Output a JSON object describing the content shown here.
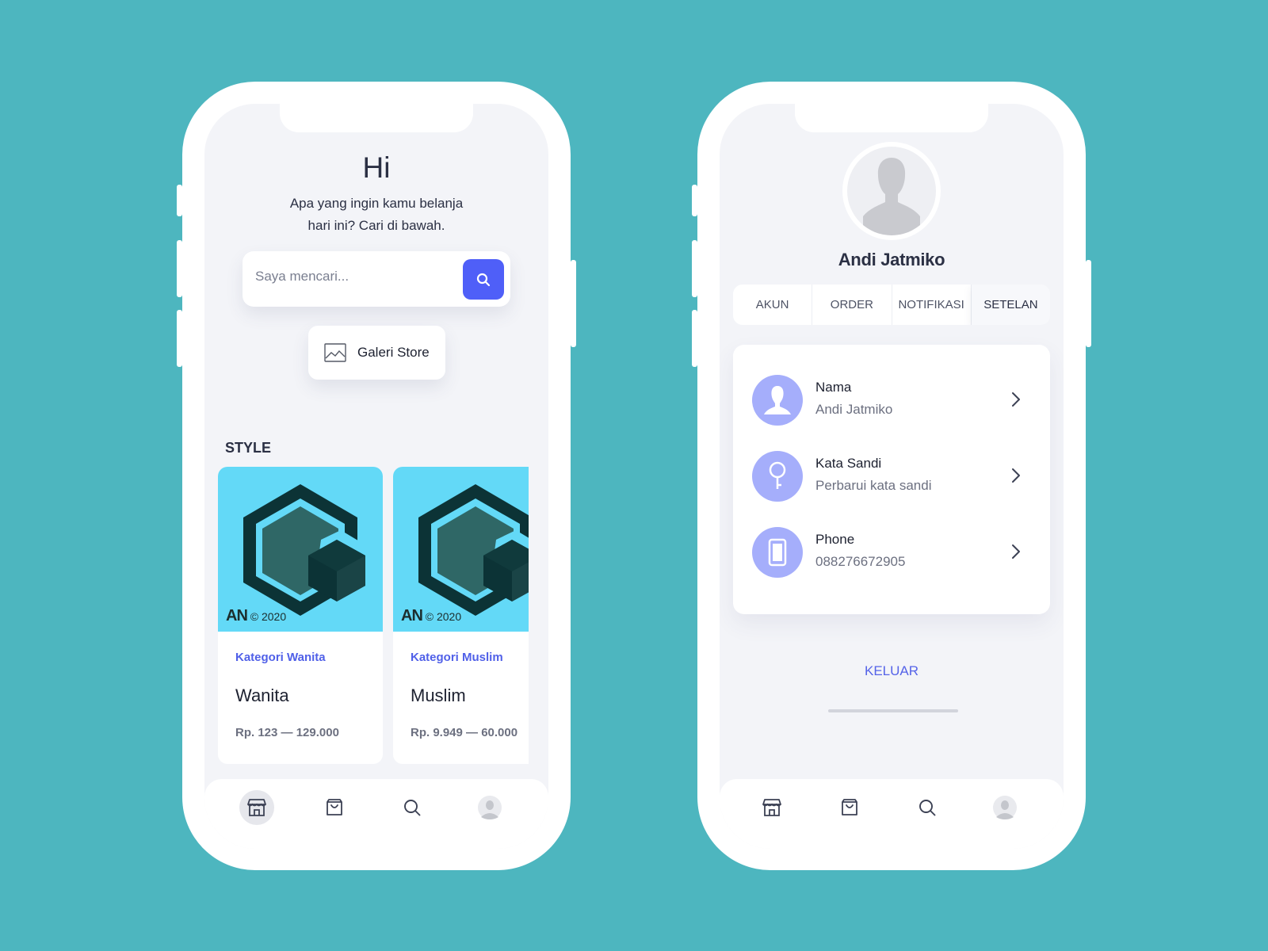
{
  "home": {
    "greeting": "Hi",
    "subtitle_line1": "Apa yang ingin kamu belanja",
    "subtitle_line2": "hari ini? Cari di bawah.",
    "search_placeholder": "Saya mencari...",
    "gallery_button": "Galeri Store",
    "section_title": "STYLE",
    "cards": [
      {
        "logo": "AN",
        "copyright": "© 2020",
        "category": "Kategori Wanita",
        "name": "Wanita",
        "price": "Rp. 123 — 129.000"
      },
      {
        "logo": "AN",
        "copyright": "© 2020",
        "category": "Kategori Muslim",
        "name": "Muslim",
        "price": "Rp. 9.949 — 60.000"
      }
    ]
  },
  "profile": {
    "name": "Andi Jatmiko",
    "tabs": [
      "AKUN",
      "ORDER",
      "NOTIFIKASI",
      "SETELAN"
    ],
    "active_tab": "SETELAN",
    "rows": [
      {
        "label": "Nama",
        "value": "Andi Jatmiko",
        "icon": "user-icon"
      },
      {
        "label": "Kata Sandi",
        "value": "Perbarui kata sandi",
        "icon": "key-icon"
      },
      {
        "label": "Phone",
        "value": "088276672905",
        "icon": "phone-icon"
      }
    ],
    "logout": "KELUAR"
  },
  "nav": {
    "items": [
      "store-icon",
      "bag-icon",
      "search-icon",
      "avatar"
    ]
  },
  "colors": {
    "background": "#4db6bf",
    "accent": "#4f5ff8",
    "icon_circle": "#a5aefb",
    "card_image": "#63d9f7"
  }
}
